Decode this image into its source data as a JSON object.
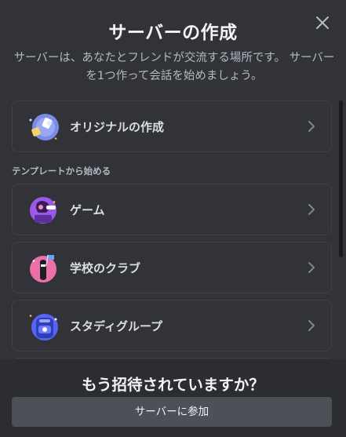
{
  "modal": {
    "title": "サーバーの作成",
    "description": "サーバーは、あなたとフレンドが交流する場所です。 サーバーを1つ作って会話を始めましょう。",
    "close_icon": "close-icon"
  },
  "create_own": {
    "label": "オリジナルの作成",
    "icon": "create-server-art"
  },
  "templates": {
    "section_label": "テンプレートから始める",
    "items": [
      {
        "label": "ゲーム",
        "icon": "gaming-art"
      },
      {
        "label": "学校のクラブ",
        "icon": "school-club-art"
      },
      {
        "label": "スタディグループ",
        "icon": "study-group-art"
      }
    ]
  },
  "footer": {
    "title": "もう招待されていますか？",
    "join_label": "サーバーに参加"
  },
  "colors": {
    "background": "#313338",
    "footer_background": "#2b2d31",
    "button_secondary": "#4e5058",
    "text_muted": "#b5bac1"
  }
}
